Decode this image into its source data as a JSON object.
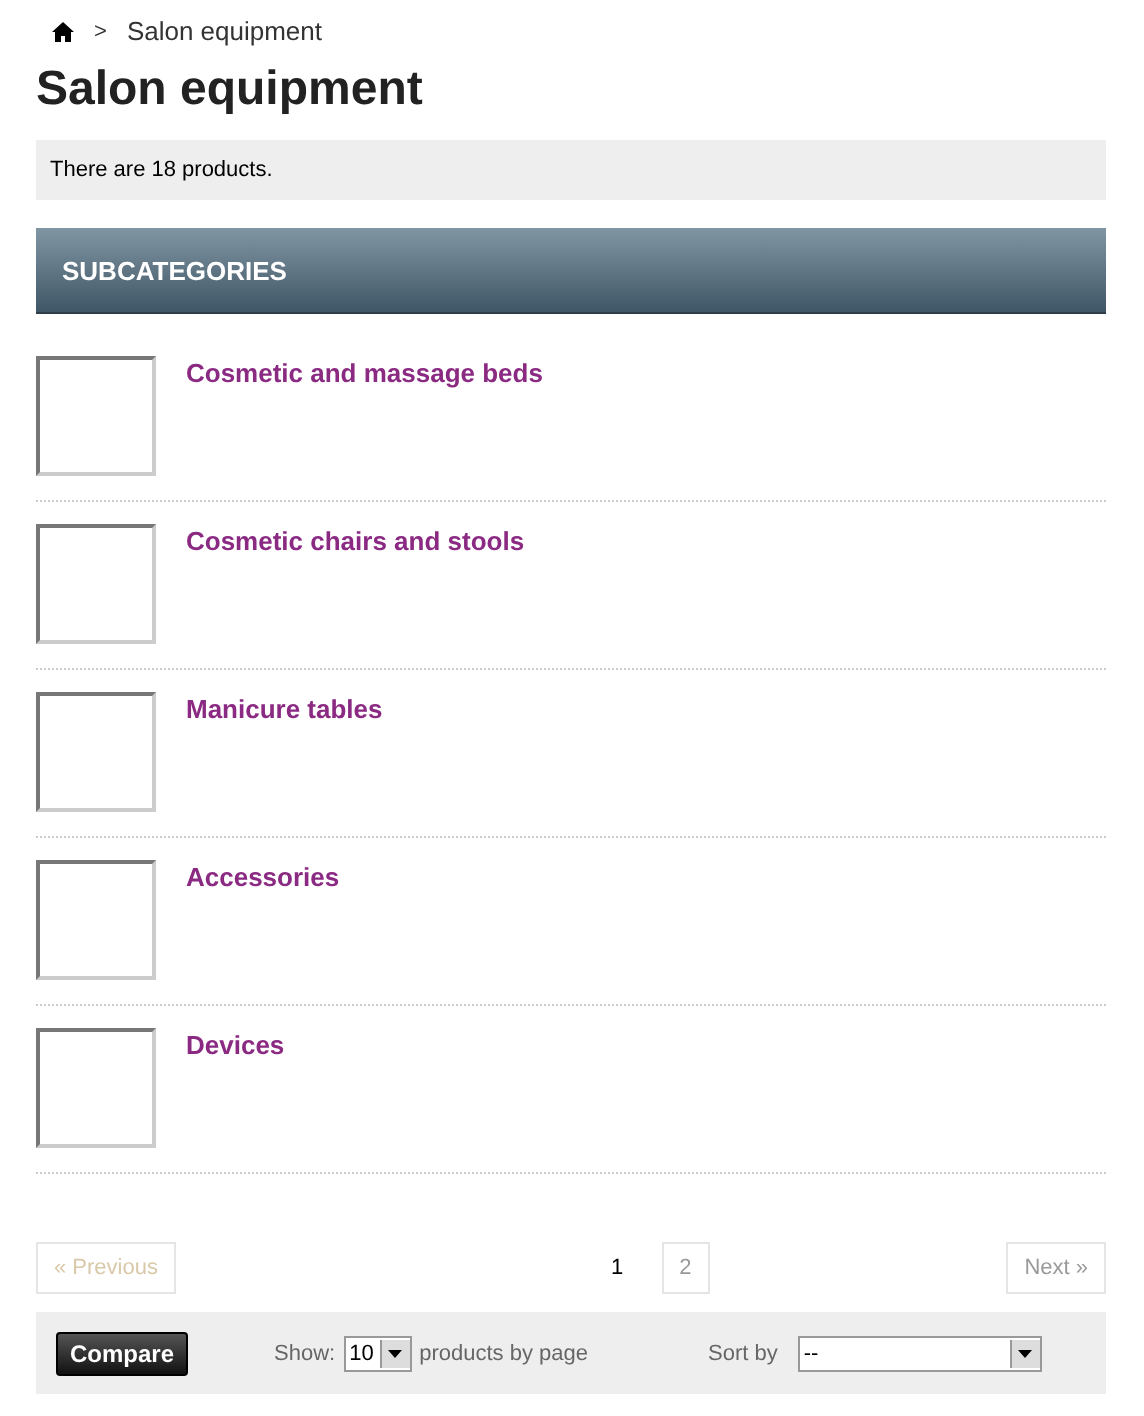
{
  "breadcrumb": {
    "current": "Salon equipment",
    "separator": ">"
  },
  "title": "Salon equipment",
  "product_count": "There are 18 products.",
  "subcategories": {
    "heading": "SUBCATEGORIES",
    "items": [
      {
        "name": "Cosmetic and massage beds"
      },
      {
        "name": "Cosmetic chairs and stools"
      },
      {
        "name": "Manicure tables"
      },
      {
        "name": "Accessories"
      },
      {
        "name": "Devices"
      }
    ]
  },
  "pagination": {
    "previous": {
      "label": "« Previous",
      "disabled": true
    },
    "pages": [
      {
        "label": "1",
        "selected": true
      },
      {
        "label": "2",
        "selected": false
      }
    ],
    "next": {
      "label": "Next »",
      "disabled": false
    }
  },
  "toolbar": {
    "compare": "Compare",
    "show_label": "Show:",
    "per_page": "10",
    "per_page_suffix": "products by page",
    "sort_label": "Sort by",
    "sort_value": "--"
  }
}
